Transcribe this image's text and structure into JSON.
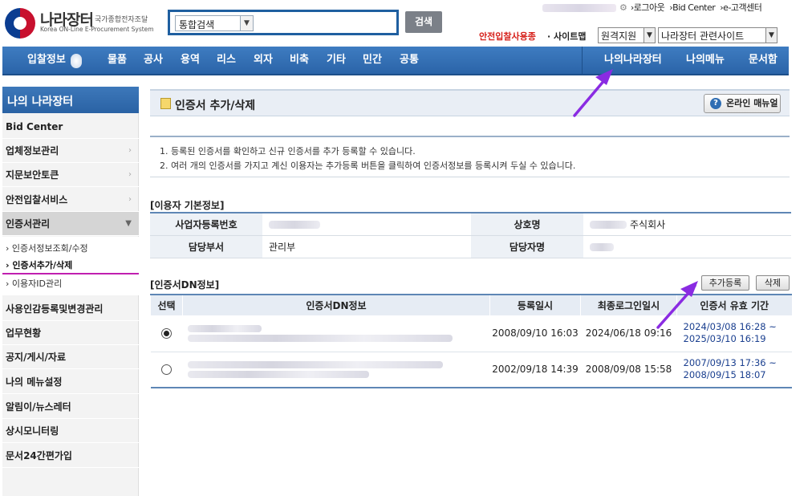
{
  "header": {
    "logo_name": "나라장터",
    "logo_sub1": "국가종합전자조달",
    "logo_sub2": "Korea ON-Line E-Procurement System",
    "search_select_value": "통합검색",
    "search_button": "검색",
    "top_links": [
      "›로그아웃",
      "›Bid Center",
      "›e-고객센터"
    ],
    "safe_bid_link": "안전입찰사용종",
    "sitemap_link": "· 사이트맵",
    "remote_select_value": "원격지원",
    "related_select_value": "나라장터 관련사이트"
  },
  "nav": {
    "items_left": [
      "입찰정보",
      "물품",
      "공사",
      "용역",
      "리스",
      "외자",
      "비축",
      "기타",
      "민간",
      "공통"
    ],
    "items_right": [
      "나의나라장터",
      "나의메뉴",
      "문서함"
    ]
  },
  "sidebar": {
    "title": "나의 나라장터",
    "items": [
      {
        "label": "Bid Center",
        "chev": ""
      },
      {
        "label": "업체정보관리",
        "chev": "›"
      },
      {
        "label": "지문보안토큰",
        "chev": "›"
      },
      {
        "label": "안전입찰서비스",
        "chev": "›"
      },
      {
        "label": "인증서관리",
        "chev": "▼"
      }
    ],
    "sub_items": [
      "› 인증서정보조회/수정",
      "› 인증서추가/삭제",
      "› 이용자ID관리"
    ],
    "items_after": [
      "사용인감등록및변경관리",
      "업무현황",
      "공지/게시/자료",
      "나의 메뉴설정",
      "알림이/뉴스레터",
      "상시모니터링",
      "문서24간편가입"
    ]
  },
  "page": {
    "title": "인증서 추가/삭제",
    "manual_button": "온라인 매뉴얼",
    "info_lines": [
      "1. 등록된 인증서를 확인하고 신규 인증서를 추가 등록할 수 있습니다.",
      "2. 여러 개의 인증서를 가지고 계신 이용자는 추가등록 버튼을 클릭하여 인증서정보를 등록시켜 두실 수 있습니다."
    ]
  },
  "user_info": {
    "section_title": "[이용자 기본정보]",
    "biz_no_label": "사업자등록번호",
    "company_label": "상호명",
    "company_value": "주식회사",
    "dept_label": "담당부서",
    "dept_value": "관리부",
    "manager_label": "담당자명"
  },
  "dn": {
    "section_title": "[인증서DN정보]",
    "add_button": "추가등록",
    "delete_button": "삭제",
    "headers": [
      "선택",
      "인증서DN정보",
      "등록일시",
      "최종로그인일시",
      "인증서 유효 기간"
    ],
    "rows": [
      {
        "selected": true,
        "registered": "2008/09/10 16:03",
        "last_login": "2024/06/18 09:16",
        "valid_from": "2024/03/08 16:28 ~",
        "valid_to": "2025/03/10 16:19"
      },
      {
        "selected": false,
        "registered": "2002/09/18 14:39",
        "last_login": "2008/09/08 15:58",
        "valid_from": "2007/09/13 17:36 ~",
        "valid_to": "2008/09/15 18:07"
      }
    ]
  }
}
